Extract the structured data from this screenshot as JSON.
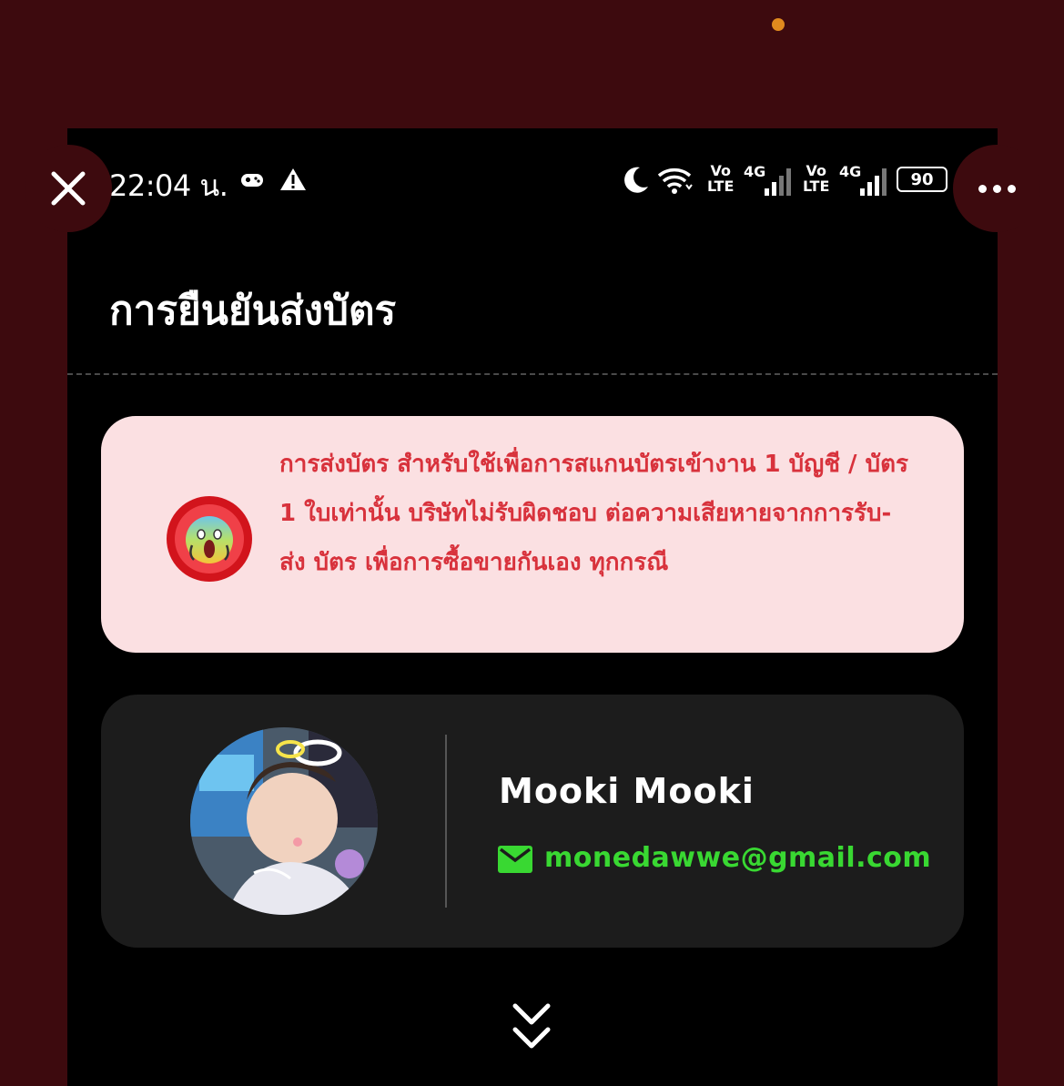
{
  "status_bar": {
    "time": "22:04 น.",
    "volte_top": "Vo",
    "volte_bottom": "LTE",
    "network": "4G",
    "battery": "90"
  },
  "page": {
    "title": "การยืนยันส่งบัตร"
  },
  "warning": {
    "text": "การส่งบัตร สำหรับใช้เพื่อการสแกนบัตรเข้างาน 1 บัญชี / บัตร 1 ใบเท่านั้น บริษัทไม่รับผิดชอบ ต่อความเสียหายจากการรับ-ส่ง บัตร เพื่อการซื้อขายกันเอง ทุกกรณี",
    "icon": "scream-face-icon"
  },
  "user": {
    "name": "Mooki Mooki",
    "email": "monedawwe@gmail.com"
  },
  "colors": {
    "background": "#3d0a0e",
    "warning_bg": "#fbe0e2",
    "warning_text": "#d8323c",
    "email": "#39d832",
    "card": "#1c1c1c"
  }
}
